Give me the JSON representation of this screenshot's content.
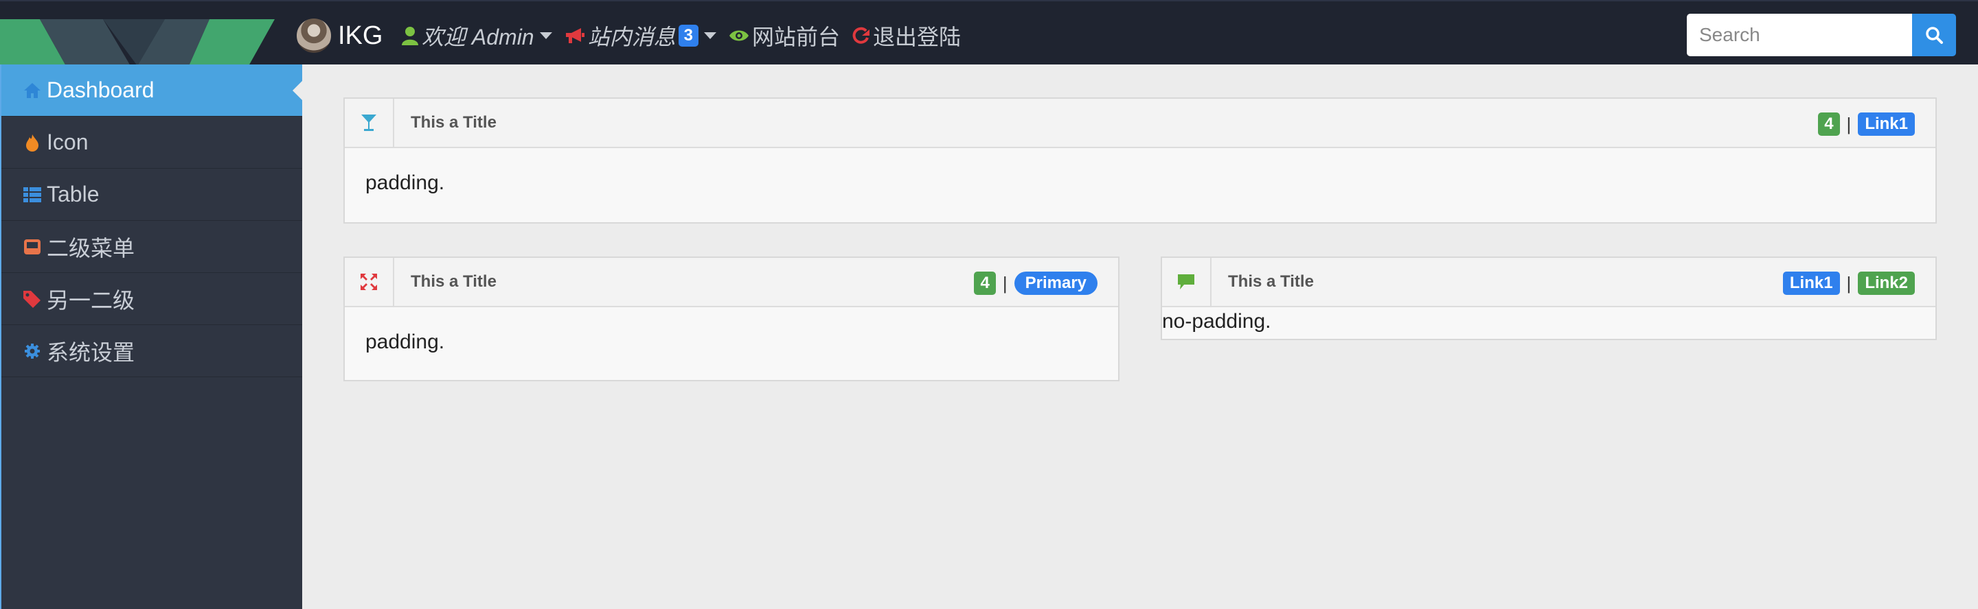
{
  "header": {
    "brand": "IKG",
    "welcome": "欢迎 Admin",
    "messages_label": "站内消息",
    "messages_count": "3",
    "frontend_label": "网站前台",
    "logout_label": "退出登陆",
    "search_placeholder": "Search"
  },
  "sidebar": {
    "items": [
      {
        "label": "Dashboard",
        "icon": "home-icon",
        "active": true
      },
      {
        "label": "Icon",
        "icon": "fire-icon"
      },
      {
        "label": "Table",
        "icon": "table-icon"
      },
      {
        "label": "二级菜单",
        "icon": "inbox-icon"
      },
      {
        "label": "另一二级",
        "icon": "tags-icon"
      },
      {
        "label": "系统设置",
        "icon": "gear-icon"
      }
    ]
  },
  "panels": [
    {
      "title": "This a Title",
      "icon": "cocktail-icon",
      "count": "4",
      "link": "Link1",
      "body": "padding."
    },
    {
      "title": "This a Title",
      "icon": "fullscreen-icon",
      "count": "4",
      "link": "Primary",
      "body": "padding."
    },
    {
      "title": "This a Title",
      "icon": "comment-icon",
      "link1": "Link1",
      "link2": "Link2",
      "body": "no-padding."
    }
  ],
  "colors": {
    "topbar": "#1f2430",
    "sidebar": "#2f3542",
    "active": "#4aa3e0",
    "primary": "#2f80ed",
    "success": "#4fa34f"
  }
}
